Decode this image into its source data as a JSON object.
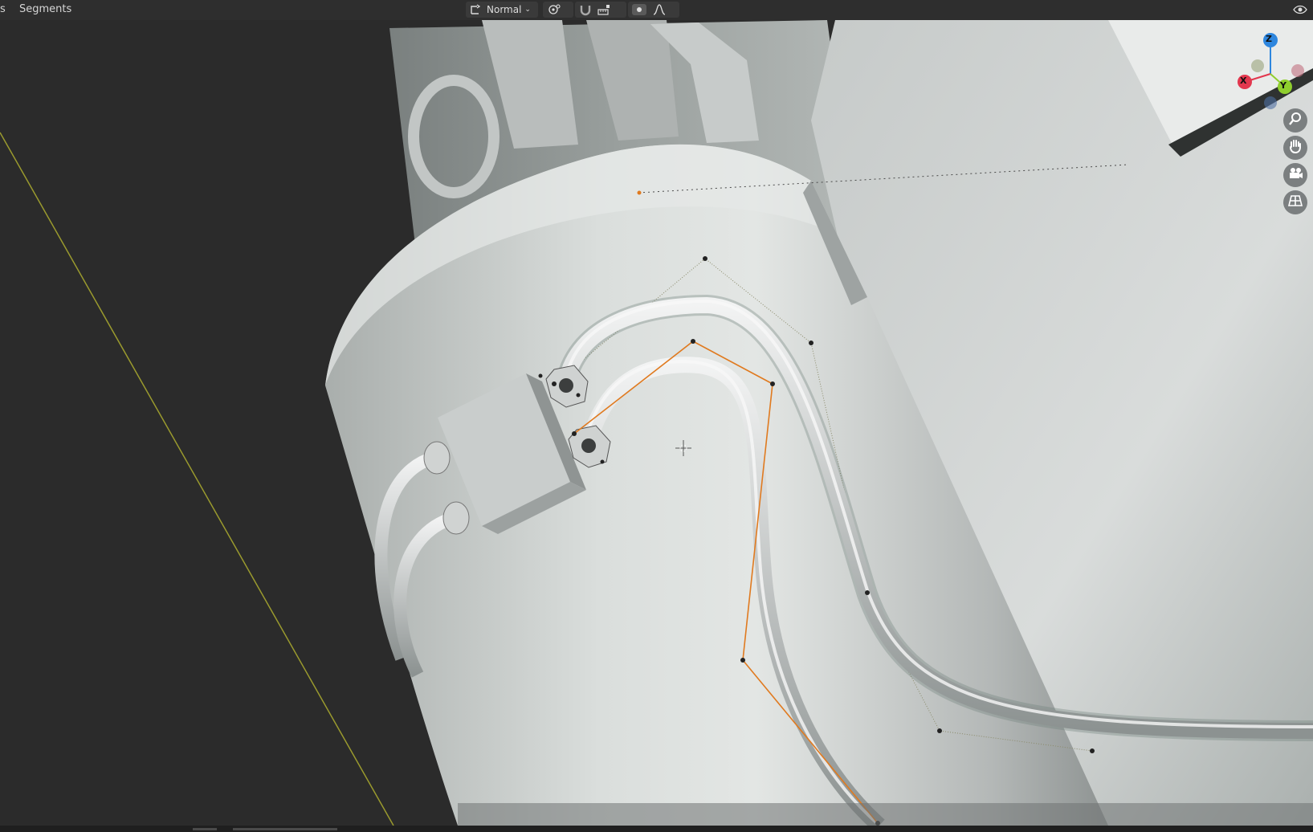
{
  "header": {
    "menu_left_partial": "s",
    "menu_segments": "Segments",
    "transform_orientation": "Normal"
  },
  "colors": {
    "ui_bg": "#2e2e2e",
    "viewport_bg": "#2b2b2b",
    "selected_curve": "#e07a1f",
    "gizmo_x": "#e2374e",
    "gizmo_y": "#8fcf2d",
    "gizmo_z": "#2e86de"
  },
  "gizmo": {
    "x": "X",
    "y": "Y",
    "z": "Z"
  },
  "icons": [
    "transform-orientation-icon",
    "pivot-point-icon",
    "snap-magnet-icon",
    "snap-target-icon",
    "proportional-edit-icon",
    "falloff-curve-icon",
    "zoom-icon",
    "pan-hand-icon",
    "camera-icon",
    "perspective-grid-icon",
    "3d-cursor-icon"
  ]
}
